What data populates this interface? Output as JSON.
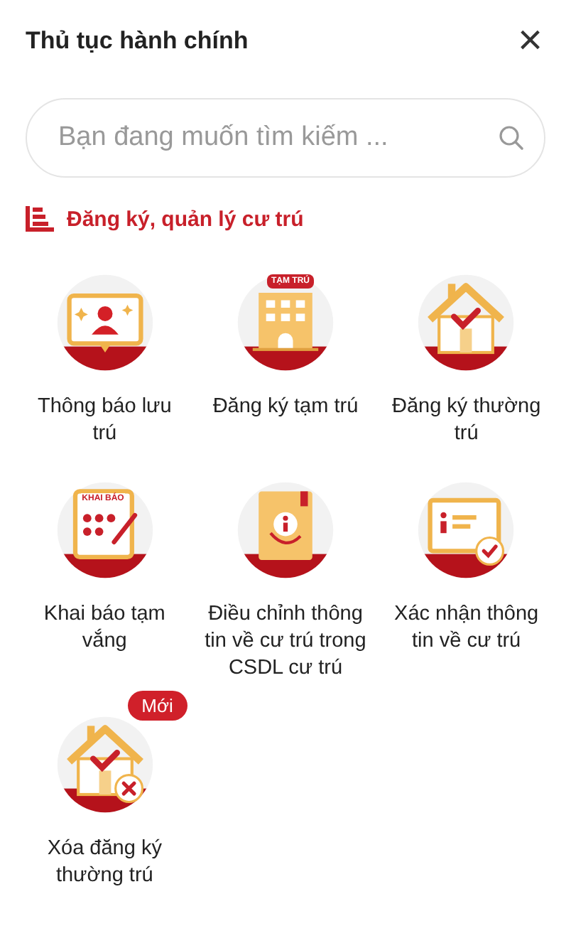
{
  "header": {
    "title": "Thủ tục hành chính",
    "close": "×"
  },
  "search": {
    "placeholder": "Bạn đang muốn tìm kiếm ..."
  },
  "section": {
    "title": "Đăng ký, quản lý cư trú"
  },
  "items": [
    {
      "label": "Thông báo lưu trú",
      "kind": "notice"
    },
    {
      "label": "Đăng ký tạm trú",
      "kind": "building",
      "icon_text": "TẠM TRÚ"
    },
    {
      "label": "Đăng ký thường trú",
      "kind": "house-check"
    },
    {
      "label": "Khai báo tạm vắng",
      "kind": "form",
      "icon_text": "KHAI BÁO"
    },
    {
      "label": "Điều chỉnh thông tin về cư trú trong CSDL cư trú",
      "kind": "book-info"
    },
    {
      "label": "Xác nhận thông tin về cư trú",
      "kind": "info-check"
    },
    {
      "label": "Xóa đăng ký thường trú",
      "kind": "house-remove",
      "badge": "Mới"
    }
  ]
}
